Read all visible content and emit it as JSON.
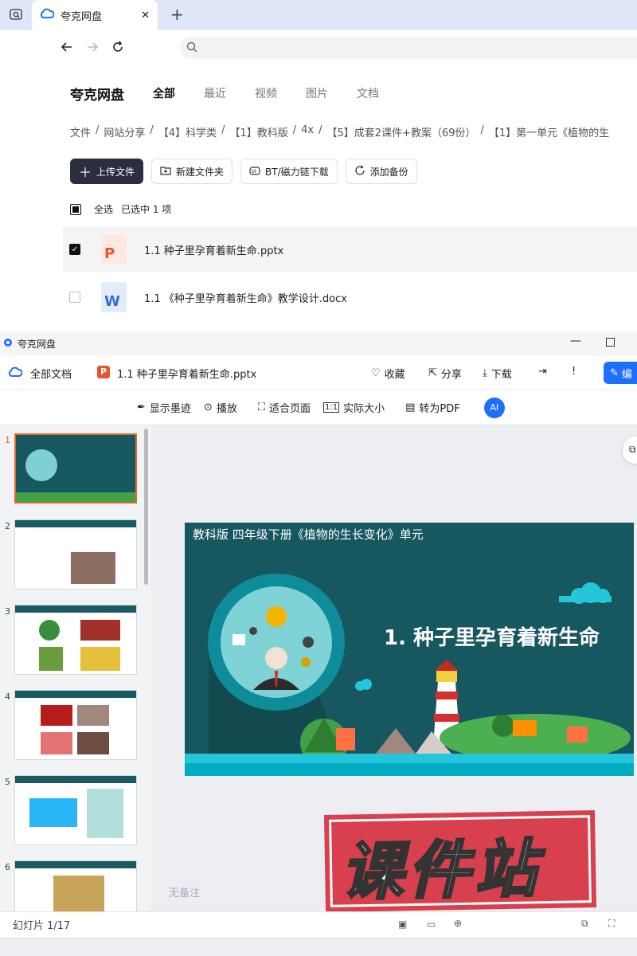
{
  "browser": {
    "tab_title": "夸克网盘",
    "tab_close": "✕",
    "new_tab": "+"
  },
  "drive": {
    "brand": "夸克网盘",
    "nav": [
      "全部",
      "最近",
      "视频",
      "图片",
      "文档"
    ],
    "breadcrumbs": [
      "文件",
      "/",
      "网站分享",
      "/",
      "【4】科学类",
      "/",
      "【1】教科版",
      "/",
      "4x",
      "/",
      "【5】成套2课件+教案（69份）",
      "/",
      "【1】第一单元《植物的生"
    ],
    "actions": {
      "upload": "上传文件",
      "new_folder": "新建文件夹",
      "bt": "BT/磁力链下载",
      "backup": "添加备份"
    },
    "select_all": "全选",
    "selected_text": "已选中  1  项",
    "files": [
      {
        "name": "1.1 种子里孕育着新生命.pptx",
        "type": "P",
        "color": "#e4572e",
        "checked": true
      },
      {
        "name": "1.1 《种子里孕育着新生命》教学设计.docx",
        "type": "W",
        "color": "#2b6fd8",
        "checked": false
      }
    ]
  },
  "viewer": {
    "window_title": "夸克网盘",
    "all_docs": "全部文档",
    "file_name": "1.1 种子里孕育着新生命.pptx",
    "actions": {
      "fav": "收藏",
      "share": "分享",
      "download": "下载",
      "edit": "编"
    },
    "tools": {
      "ink": "显示墨迹",
      "play": "播放",
      "fit": "适合页面",
      "actual": "实际大小",
      "pdf": "转为PDF"
    },
    "thumb_numbers": [
      "1",
      "2",
      "3",
      "4",
      "5",
      "6"
    ],
    "slide": {
      "header": "教科版  四年级下册《植物的生长变化》单元",
      "title": "1. 种子里孕育着新生命"
    },
    "notes": "无备注",
    "status": "幻灯片 1/17",
    "watermark": "课件站"
  },
  "colors": {
    "accent": "#1f6fff",
    "slide_bg": "#17575f",
    "watermark": "#d9404e"
  }
}
